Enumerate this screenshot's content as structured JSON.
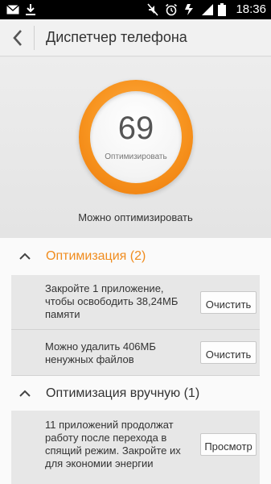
{
  "status_bar": {
    "time": "18:36",
    "left_icons": [
      "mail-icon",
      "download-icon"
    ],
    "right_icons": [
      "mute-icon",
      "alarm-icon",
      "nfc-icon",
      "signal-icon",
      "battery-icon"
    ]
  },
  "app_bar": {
    "title": "Диспетчер телефона",
    "back_icon": "back-arrow-icon"
  },
  "score": {
    "value": "69",
    "label": "Оптимизировать",
    "status": "Можно оптимизировать"
  },
  "sections": [
    {
      "title": "Оптимизация (2)",
      "color": "#f08c1e",
      "items": [
        {
          "text": "Закройте 1 приложение, чтобы освободить 38,24МБ памяти",
          "button": "Очистить"
        },
        {
          "text": "Можно удалить 406МБ ненужных файлов",
          "button": "Очистить"
        }
      ]
    },
    {
      "title": "Оптимизация вручную (1)",
      "color": "#333333",
      "items": [
        {
          "text": "11 приложений продолжат работу после перехода в спящий режим. Закройте их для экономии энергии",
          "button": "Просмотр"
        }
      ]
    }
  ],
  "colors": {
    "accent": "#f7931e",
    "accent_text": "#f08c1e"
  }
}
